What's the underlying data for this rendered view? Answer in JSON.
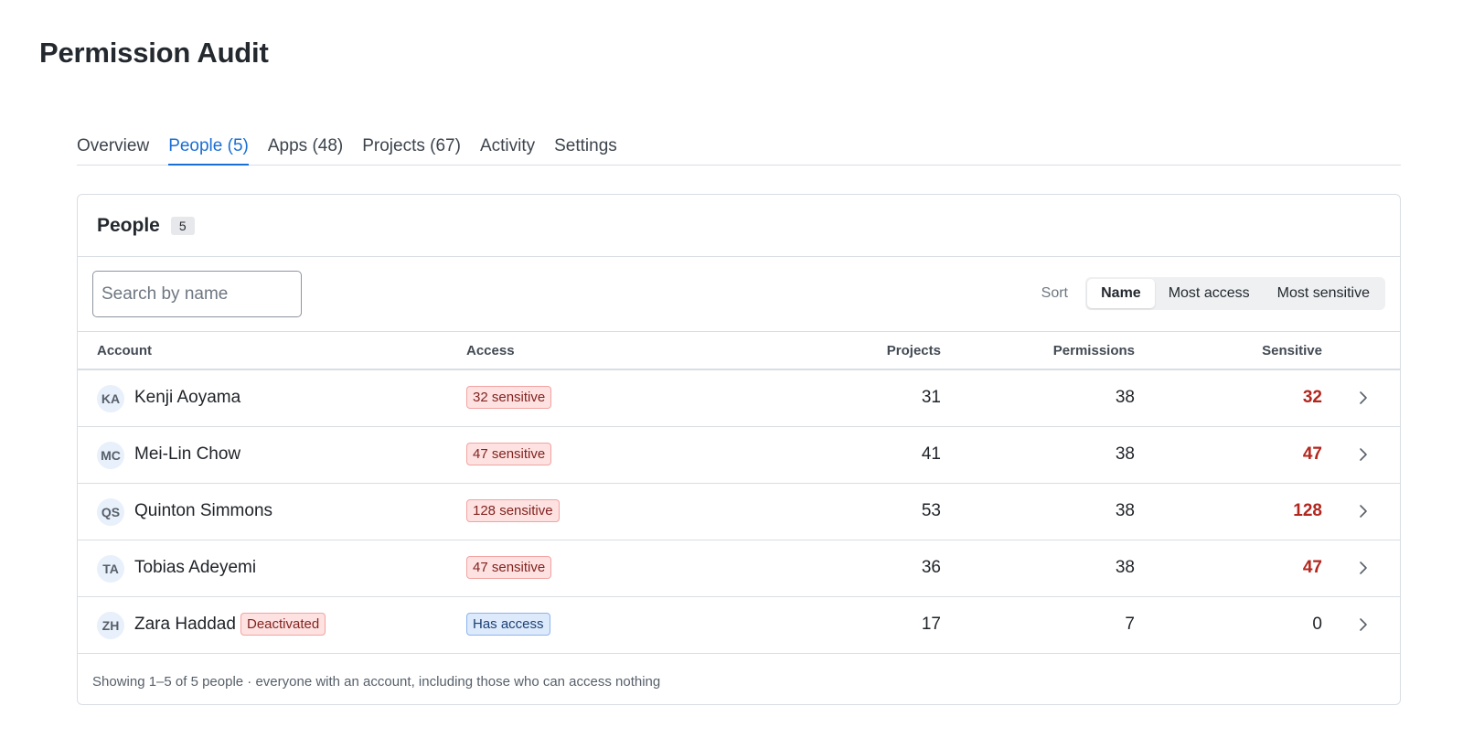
{
  "page": {
    "title": "Permission Audit"
  },
  "tabs": [
    {
      "label": "Overview"
    },
    {
      "label": "People (5)"
    },
    {
      "label": "Apps (48)"
    },
    {
      "label": "Projects (67)"
    },
    {
      "label": "Activity"
    },
    {
      "label": "Settings"
    }
  ],
  "active_tab": "People (5)",
  "card": {
    "title": "People",
    "count": "5",
    "search": {
      "placeholder": "Search by name",
      "value": ""
    },
    "sort": {
      "label": "Sort",
      "options": [
        "Name",
        "Most access",
        "Most sensitive"
      ],
      "selected": "Name"
    },
    "columns": {
      "account": "Account",
      "access": "Access",
      "projects": "Projects",
      "permissions": "Permissions",
      "sensitive": "Sensitive"
    },
    "rows": [
      {
        "initials": "KA",
        "name": "Kenji Aoyama",
        "access": "32 sensitive",
        "projects": "31",
        "permissions": "38",
        "sensitive": "32"
      },
      {
        "initials": "MC",
        "name": "Mei-Lin Chow",
        "access": "47 sensitive",
        "projects": "41",
        "permissions": "38",
        "sensitive": "47"
      },
      {
        "initials": "QS",
        "name": "Quinton Simmons",
        "access": "128 sensitive",
        "projects": "53",
        "permissions": "38",
        "sensitive": "128"
      },
      {
        "initials": "TA",
        "name": "Tobias Adeyemi",
        "access": "47 sensitive",
        "projects": "36",
        "permissions": "38",
        "sensitive": "47"
      },
      {
        "initials": "ZH",
        "name": "Zara Haddad",
        "status": "Deactivated",
        "access": "Has access",
        "projects": "17",
        "permissions": "7",
        "sensitive": "0"
      }
    ],
    "footer": "Showing 1–5 of 5 people · everyone with an account, including those who can access nothing"
  },
  "colors": {
    "accent": "#1a6fd4",
    "sensitive_text": "#b3261e",
    "badge_red_bg": "#fde2e1",
    "badge_blue_bg": "#ddeafc"
  },
  "icons": {
    "row_action": "chevron-right-icon"
  }
}
